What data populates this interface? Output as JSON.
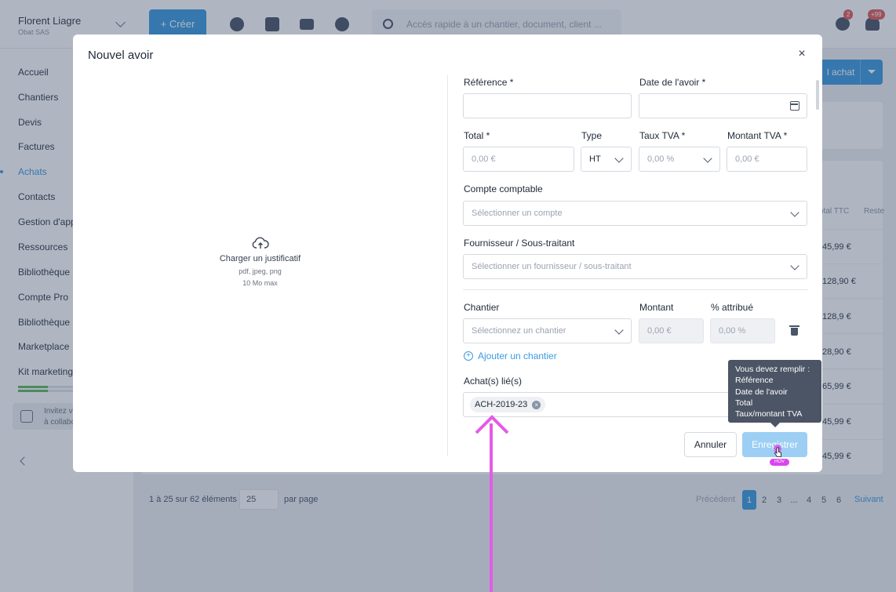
{
  "header": {
    "company_name": "Florent Liagre",
    "company_sub": "Obat SAS",
    "create_label": "+  Créer",
    "search_placeholder": "Accès rapide à un chantier, document, client ...",
    "messages_badge": "2",
    "notifications_badge": "+99"
  },
  "sidebar": {
    "items": [
      "Accueil",
      "Chantiers",
      "Devis",
      "Factures",
      "Achats",
      "Contacts",
      "Gestion d'app",
      "Ressources",
      "Bibliothèque",
      "Compte Pro",
      "Bibliothèque",
      "Marketplace",
      "Kit marketing"
    ],
    "active_item": "Achats",
    "invite_line1": "Invitez v",
    "invite_line2": "à collabo"
  },
  "background": {
    "achat_button_label": "l achat",
    "col_total_ttc": "otal TTC",
    "col_reste": "Reste",
    "row_values": [
      "45,99 €",
      "128,90 €",
      "128,9 €",
      "28,90 €",
      "65,99 €",
      "45,99 €",
      "45,99 €"
    ],
    "pagination_info": "1 à 25 sur 62 éléments",
    "per_page_value": "25",
    "per_page_label": "par page",
    "prev_label": "Précédent",
    "next_label": "Suivant",
    "pages": [
      "1",
      "2",
      "3",
      "...",
      "4",
      "5",
      "6"
    ],
    "current_page": "1"
  },
  "modal": {
    "title": "Nouvel avoir",
    "close_glyph": "×",
    "upload_title": "Charger un justificatif",
    "upload_formats": "pdf, jpeg, png",
    "upload_max": "10 Mo max",
    "reference_label": "Référence *",
    "date_label": "Date de l'avoir *",
    "total_label": "Total *",
    "total_placeholder": "0,00 €",
    "type_label": "Type",
    "type_value": "HT",
    "taux_tva_label": "Taux TVA *",
    "taux_tva_placeholder": "0,00 %",
    "montant_tva_label": "Montant TVA *",
    "montant_tva_placeholder": "0,00 €",
    "compte_label": "Compte comptable",
    "compte_placeholder": "Sélectionner un compte",
    "fournisseur_label": "Fournisseur / Sous-traitant",
    "fournisseur_placeholder": "Sélectionner un fournisseur / sous-traitant",
    "chantier_label": "Chantier",
    "chantier_placeholder": "Sélectionnez un chantier",
    "montant_label": "Montant",
    "montant_placeholder": "0,00 €",
    "attribue_label": "% attribué",
    "attribue_placeholder": "0,00 %",
    "add_chantier_label": "Ajouter un chantier",
    "achats_lies_label": "Achat(s) lié(s)",
    "linked_tag": "ACH-2019-23",
    "cancel_label": "Annuler",
    "save_label": "Enregistrer",
    "tooltip_lines": [
      "Vous devez  remplir :",
      "Référence",
      "Date de l'avoir",
      "Total",
      "Taux/montant TVA"
    ],
    "hover_badge": "HOV"
  },
  "colors": {
    "accent": "#3b9ae1",
    "annotation": "#e35ce8",
    "save_disabled": "#9ccff3",
    "tooltip_bg": "#4b5565"
  }
}
